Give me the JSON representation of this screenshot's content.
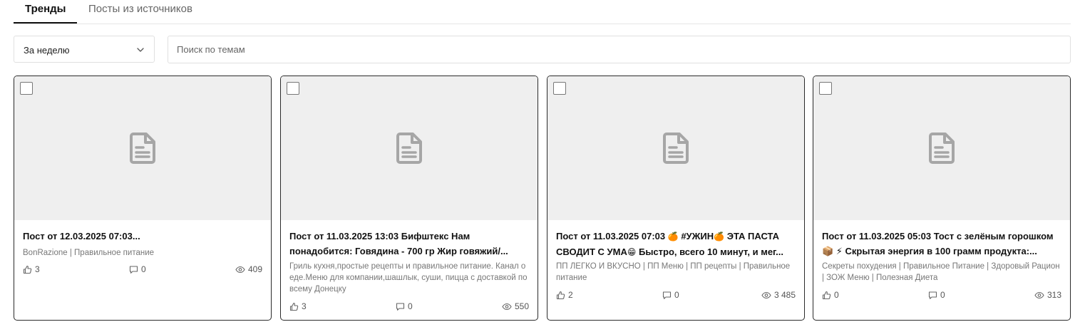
{
  "tabs": [
    {
      "label": "Тренды",
      "active": true
    },
    {
      "label": "Посты из источников",
      "active": false
    }
  ],
  "filters": {
    "period_value": "За неделю",
    "search_placeholder": "Поиск по темам"
  },
  "cards": [
    {
      "title": "Пост от 12.03.2025 07:03...",
      "source": "BonRazione | Правильное питание",
      "likes": "3",
      "comments": "0",
      "views": "409"
    },
    {
      "title": "Пост от 11.03.2025 13:03 Бифштекс Нам понадобится: Говядина - 700 гр Жир говяжий/...",
      "source": "Гриль кухня,простые рецепты и правильное питание. Канал о еде.Меню для компании,шашлык, суши, пицца с доставкой по всему Донецку",
      "likes": "3",
      "comments": "0",
      "views": "550"
    },
    {
      "title_parts": [
        "Пост от 11.03.2025 07:03 ",
        "🍊",
        " #УЖИН",
        "🍊",
        "  ЭТА ПАСТА СВОДИТ С УМА",
        "😁",
        " Быстро, всего 10 минут, и мег..."
      ],
      "title": "Пост от 11.03.2025 07:03 🍊 #УЖИН🍊  ЭТА ПАСТА СВОДИТ С УМА😁 Быстро, всего 10 минут, и мег...",
      "source": "ПП ЛЕГКО И ВКУСНО | ПП Меню | ПП рецепты | Правильное питание",
      "likes": "2",
      "comments": "0",
      "views": "3 485"
    },
    {
      "title": "Пост от 11.03.2025 05:03 Тост с зелёным горошком 📦 ⚡ Скрытая энергия в 100 грамм продукта:...",
      "source": "Секреты похудения | Правильное Питание | Здоровый Рацион | ЗОЖ Меню | Полезная Диета",
      "likes": "0",
      "comments": "0",
      "views": "313"
    }
  ],
  "icons": {
    "thumbnail_placeholder": "document-icon",
    "likes": "thumbs-up-icon",
    "comments": "comment-icon",
    "views": "eye-icon",
    "select": "chevron-down-icon"
  },
  "colors": {
    "card_border": "#2a2a2a",
    "thumb_bg": "#efefef",
    "doc_icon": "#a6a6a6",
    "muted_text": "#777777"
  }
}
